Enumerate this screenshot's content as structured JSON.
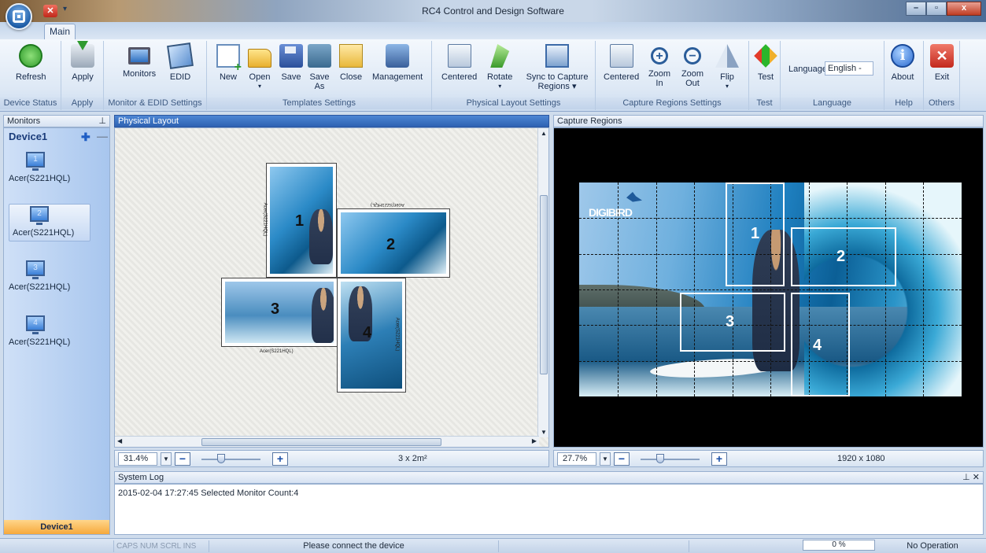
{
  "window": {
    "title": "RC4 Control and Design Software",
    "min_label": "–",
    "max_label": "▫",
    "close_label": "x"
  },
  "tabs": [
    {
      "label": "Main"
    }
  ],
  "ribbon": {
    "groups": [
      {
        "label": "Device Status",
        "buttons": [
          {
            "label": "Refresh",
            "icon": "refresh-icon"
          }
        ]
      },
      {
        "label": "Apply",
        "buttons": [
          {
            "label": "Apply",
            "icon": "apply-icon"
          }
        ]
      },
      {
        "label": "Monitor & EDID Settings",
        "buttons": [
          {
            "label": "Monitors",
            "icon": "monitor-icon"
          },
          {
            "label": "EDID",
            "icon": "edid-icon"
          }
        ]
      },
      {
        "label": "Templates Settings",
        "buttons": [
          {
            "label": "New",
            "icon": "new-icon"
          },
          {
            "label": "Open",
            "icon": "folder-icon"
          },
          {
            "label": "Save",
            "icon": "save-icon"
          },
          {
            "label": "Save As",
            "icon": "save-as-icon"
          },
          {
            "label": "Close",
            "icon": "close-template-icon"
          },
          {
            "label": "Management",
            "icon": "management-icon"
          }
        ]
      },
      {
        "label": "Physical Layout Settings",
        "buttons": [
          {
            "label": "Centered",
            "icon": "center-icon"
          },
          {
            "label": "Rotate",
            "icon": "rotate-icon"
          },
          {
            "label": "Sync to Capture Regions",
            "icon": "sync-icon"
          }
        ]
      },
      {
        "label": "Capture Regions Settings",
        "buttons": [
          {
            "label": "Centered",
            "icon": "center-icon"
          },
          {
            "label": "Zoom In",
            "icon": "zoom-in-icon"
          },
          {
            "label": "Zoom Out",
            "icon": "zoom-out-icon"
          },
          {
            "label": "Flip",
            "icon": "flip-icon"
          }
        ]
      },
      {
        "label": "Test",
        "buttons": [
          {
            "label": "Test",
            "icon": "test-icon"
          }
        ]
      },
      {
        "label": "Language",
        "language_label": "Language",
        "language_value": "English -"
      },
      {
        "label": "Help",
        "buttons": [
          {
            "label": "About",
            "icon": "about-icon"
          }
        ]
      },
      {
        "label": "Others",
        "buttons": [
          {
            "label": "Exit",
            "icon": "exit-icon"
          }
        ]
      }
    ]
  },
  "panes": {
    "monitors_title": "Monitors",
    "physical_title": "Physical Layout",
    "capture_title": "Capture Regions",
    "syslog_title": "System Log"
  },
  "device": {
    "name": "Device1",
    "footer": "Device1",
    "monitors": [
      {
        "num": "1",
        "label": "Acer(S221HQL)",
        "selected": false
      },
      {
        "num": "2",
        "label": "Acer(S221HQL)",
        "selected": true
      },
      {
        "num": "3",
        "label": "Acer(S221HQL)",
        "selected": false
      },
      {
        "num": "4",
        "label": "Acer(S221HQL)",
        "selected": false
      }
    ]
  },
  "physical": {
    "zoom": "31.4%",
    "info": "3 x 2m²",
    "screens": [
      {
        "num": "1",
        "caption": "Acer(S221HQL)"
      },
      {
        "num": "2",
        "caption": "Acer(S221HQL)"
      },
      {
        "num": "3",
        "caption": "Acer(S221HQL)"
      },
      {
        "num": "4",
        "caption": "Acer(S221HQL)"
      }
    ]
  },
  "capture": {
    "zoom": "27.7%",
    "resolution": "1920 x 1080",
    "logo": "DIGIBIRD",
    "regions": [
      "1",
      "2",
      "3",
      "4"
    ]
  },
  "syslog": {
    "entries": [
      "2015-02-04 17:27:45 Selected Monitor Count:4"
    ]
  },
  "status": {
    "keys": "CAPS  NUM  SCRL  INS",
    "message": "Please connect the device",
    "progress": "0 %",
    "operation": "No Operation"
  },
  "colors": {
    "accent": "#2e62b2",
    "device_footer": "#f6a93c",
    "exit": "#c3281c"
  }
}
